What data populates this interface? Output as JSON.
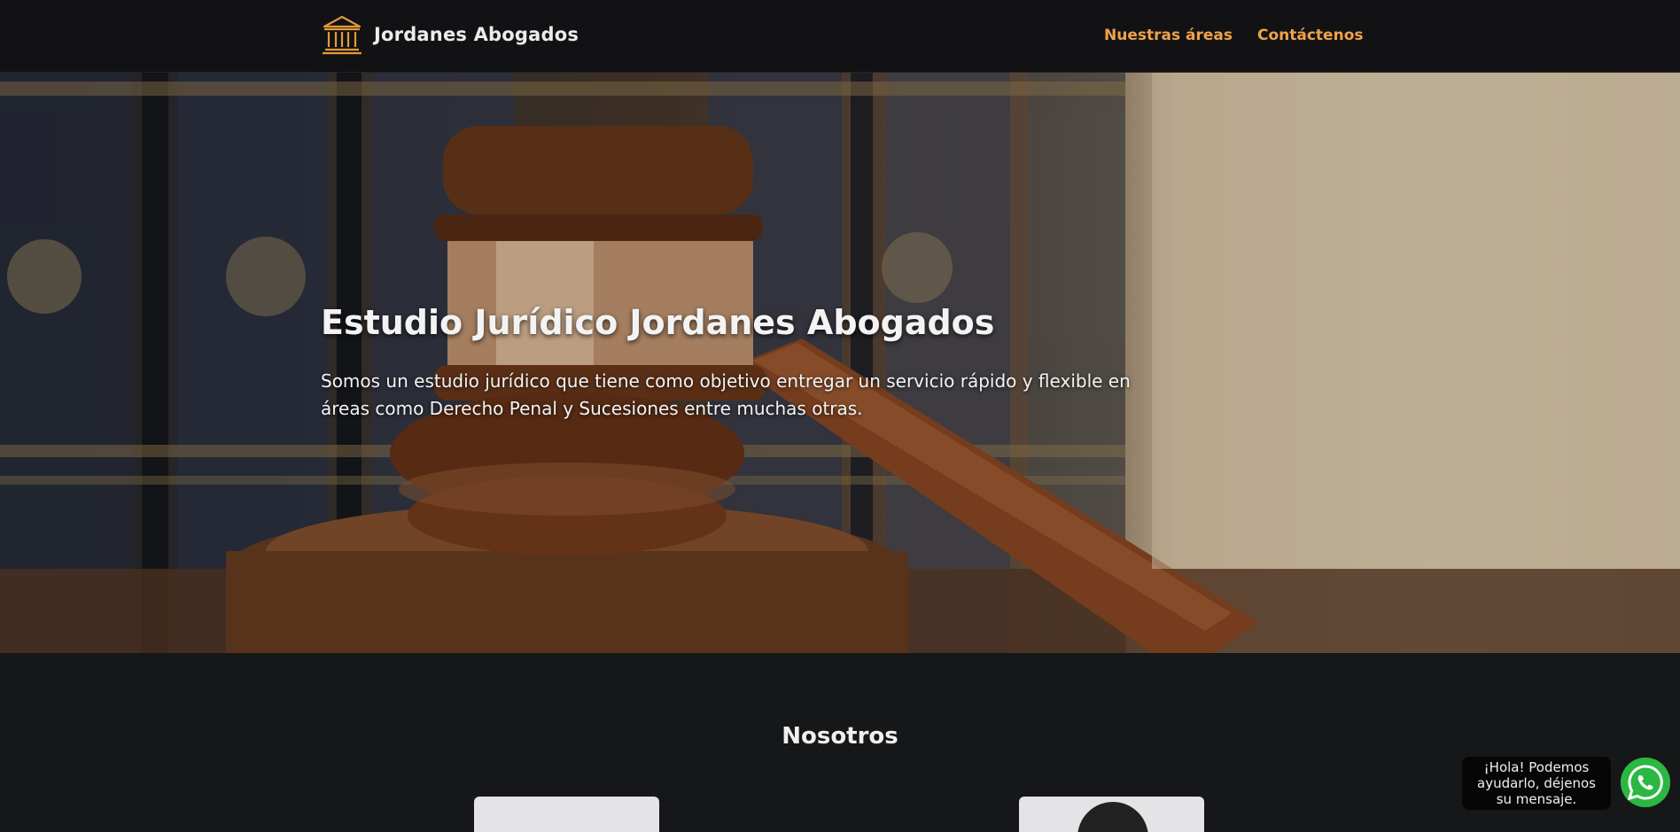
{
  "header": {
    "brand_name": "Jordanes Abogados",
    "logo_icon": "courthouse-icon",
    "nav": [
      {
        "label": "Nuestras áreas"
      },
      {
        "label": "Contáctenos"
      }
    ],
    "accent_color": "#f0a24a"
  },
  "hero": {
    "title": "Estudio Jurídico Jordanes Abogados",
    "text": "Somos un estudio jurídico que tiene como objetivo entregar un servicio rápido y flexible en áreas como Derecho Penal y Sucesiones entre muchas otras.",
    "image": "gavel-on-law-books-photo"
  },
  "about": {
    "title": "Nosotros"
  },
  "whatsapp": {
    "message": "¡Hola! Podemos ayudarlo, déjenos su mensaje.",
    "icon": "whatsapp-icon",
    "color": "#2bb741"
  }
}
